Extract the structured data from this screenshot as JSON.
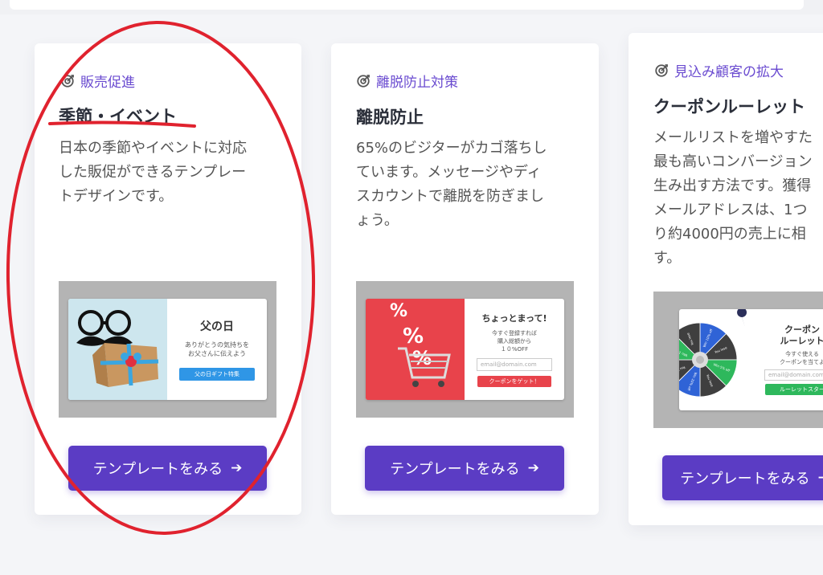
{
  "colors": {
    "accent": "#5b3cc4",
    "tag": "#6a4bd0",
    "annotation": "#e0222e"
  },
  "cards": [
    {
      "tag": "販売促進",
      "title": "季節・イベント",
      "desc": "日本の季節やイベントに対応\nした販促ができるテンプレー\nトデザインです。",
      "popup": {
        "title": "父の日",
        "text": "ありがとうの気持ちを\nお父さんに伝えよう",
        "button": "父の日ギフト特集"
      },
      "button": "テンプレートをみる"
    },
    {
      "tag": "離脱防止対策",
      "title": "離脱防止",
      "desc": "65%のビジターがカゴ落ちし\nています。メッセージやディ\nスカウントで離脱を防ぎまし\nょう。",
      "popup": {
        "title": "ちょっとまって!",
        "text": "今すぐ登録すれば\n購入総額から\n１０%OFF",
        "input": "email@domain.com",
        "button": "クーポンをゲット！"
      },
      "button": "テンプレートをみる"
    },
    {
      "tag": "見込み顧客の拡大",
      "title": "クーポンルーレット",
      "desc": "メールリストを増やすた\n最も高いコンバージョン\n生み出す方法です。獲得\nメールアドレスは、1つ\nり約4000円の売上に相\nす。",
      "popup": {
        "title": "クーポン\nルーレット",
        "text": "今すぐ使える\nクーポンを当てよ",
        "input": "email@domain.com",
        "button": "ルーレットスター"
      },
      "button": "テンプレートをみる"
    }
  ],
  "wheel_segments": [
    "Win 10% off",
    "You lose",
    "Win 5% off",
    "You lose",
    "Win 20% off",
    "You lose",
    "Win 10% off",
    "You lose"
  ]
}
